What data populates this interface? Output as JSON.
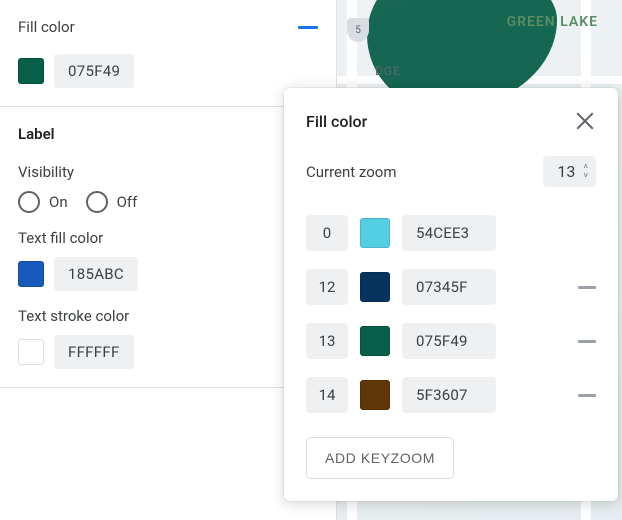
{
  "left": {
    "fill_title": "Fill color",
    "fill_swatch": "#075F49",
    "fill_hex": "075F49",
    "label_title": "Label",
    "visibility_label": "Visibility",
    "visibility_on": "On",
    "visibility_off": "Off",
    "text_fill_label": "Text fill color",
    "text_fill_swatch": "#185ABC",
    "text_fill_hex": "185ABC",
    "text_stroke_label": "Text stroke color",
    "text_stroke_swatch": "#FFFFFF",
    "text_stroke_hex": "FFFFFF"
  },
  "map": {
    "lake_label": "GREEN LAKE",
    "district_label": "DGE",
    "shield": "5"
  },
  "popup": {
    "title": "Fill color",
    "zoom_label": "Current zoom",
    "zoom_value": "13",
    "stops": [
      {
        "zoom": "0",
        "color": "#54CEE3",
        "hex": "54CEE3",
        "removable": false
      },
      {
        "zoom": "12",
        "color": "#07345F",
        "hex": "07345F",
        "removable": true
      },
      {
        "zoom": "13",
        "color": "#075F49",
        "hex": "075F49",
        "removable": true
      },
      {
        "zoom": "14",
        "color": "#5F3607",
        "hex": "5F3607",
        "removable": true
      }
    ],
    "add_label": "ADD KEYZOOM"
  }
}
